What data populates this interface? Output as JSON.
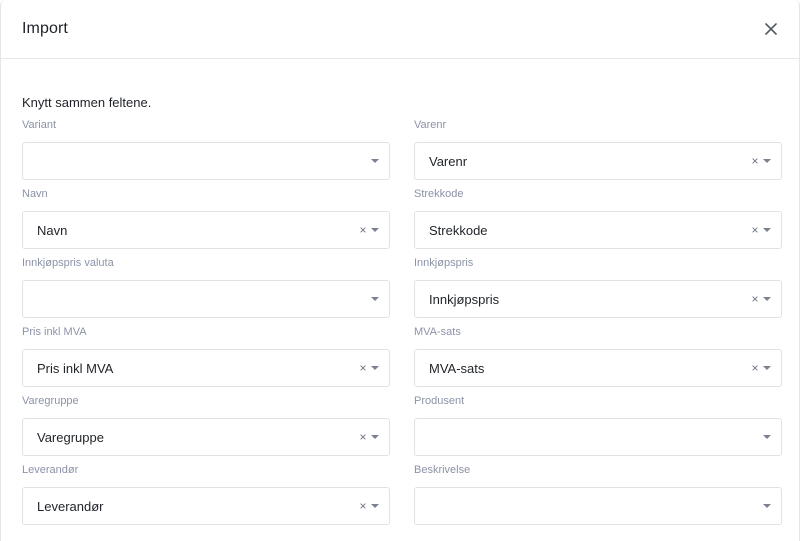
{
  "modal": {
    "title": "Import",
    "close_icon": "close-icon",
    "intro": "Knytt sammen feltene."
  },
  "fields": [
    {
      "label": "Variant",
      "value": "",
      "clearable": false
    },
    {
      "label": "Varenr",
      "value": "Varenr",
      "clearable": true
    },
    {
      "label": "Navn",
      "value": "Navn",
      "clearable": true
    },
    {
      "label": "Strekkode",
      "value": "Strekkode",
      "clearable": true
    },
    {
      "label": "Innkjøpspris valuta",
      "value": "",
      "clearable": false
    },
    {
      "label": "Innkjøpspris",
      "value": "Innkjøpspris",
      "clearable": true
    },
    {
      "label": "Pris inkl MVA",
      "value": "Pris inkl MVA",
      "clearable": true
    },
    {
      "label": "MVA-sats",
      "value": "MVA-sats",
      "clearable": true
    },
    {
      "label": "Varegruppe",
      "value": "Varegruppe",
      "clearable": true
    },
    {
      "label": "Produsent",
      "value": "",
      "clearable": false
    },
    {
      "label": "Leverandør",
      "value": "Leverandør",
      "clearable": true
    },
    {
      "label": "Beskrivelse",
      "value": "",
      "clearable": false
    }
  ],
  "clear_glyph": "×",
  "colors": {
    "label": "#8b93a7",
    "border": "#dfe2e7",
    "text": "#1f2328"
  }
}
